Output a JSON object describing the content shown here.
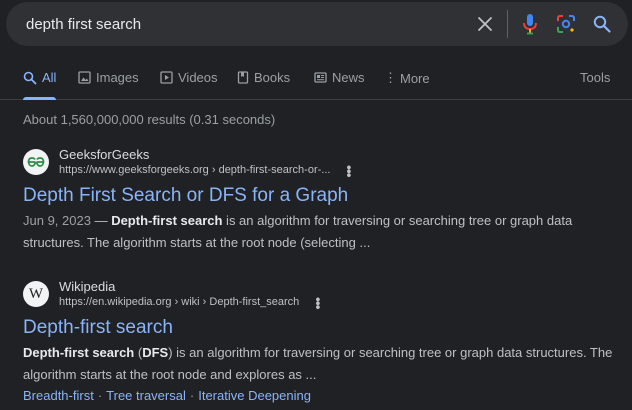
{
  "search": {
    "query": "depth first search",
    "icons": [
      "clear-icon",
      "microphone-icon",
      "lens-icon",
      "search-icon"
    ]
  },
  "tabs": [
    {
      "label": "All",
      "icon": "search-icon",
      "active": true
    },
    {
      "label": "Images",
      "icon": "image-icon"
    },
    {
      "label": "Videos",
      "icon": "video-icon"
    },
    {
      "label": "Books",
      "icon": "book-icon"
    },
    {
      "label": "News",
      "icon": "news-icon"
    },
    {
      "label": "More",
      "icon": "more-vert-icon"
    }
  ],
  "tools_label": "Tools",
  "stats": "About 1,560,000,000 results (0.31 seconds)",
  "results": [
    {
      "site_name": "GeeksforGeeks",
      "url": "https://www.geeksforgeeks.org › depth-first-search-or-...",
      "title": "Depth First Search or DFS for a Graph",
      "date": "Jun 9, 2023",
      "date_sep": " — ",
      "snippet_bold": "Depth-first search",
      "snippet_rest": " is an algorithm for traversing or searching tree or graph data structures. The algorithm starts at the root node (selecting ...",
      "favicon_text": "GG",
      "favicon_color": "#2f8d46"
    },
    {
      "site_name": "Wikipedia",
      "url": "https://en.wikipedia.org › wiki › Depth-first_search",
      "title": "Depth-first search",
      "snippet_bold": "Depth-first search",
      "snippet_mid": " (",
      "snippet_bold2": "DFS",
      "snippet_rest": ") is an algorithm for traversing or searching tree or graph data structures. The algorithm starts at the root node and explores as ...",
      "favicon_text": "W",
      "sitelinks": [
        "Breadth-first",
        "Tree traversal",
        "Iterative Deepening"
      ],
      "sitelink_sep": "·"
    }
  ],
  "colors": {
    "background": "#202124",
    "link": "#8ab4f8",
    "text": "#bdc1c6"
  }
}
